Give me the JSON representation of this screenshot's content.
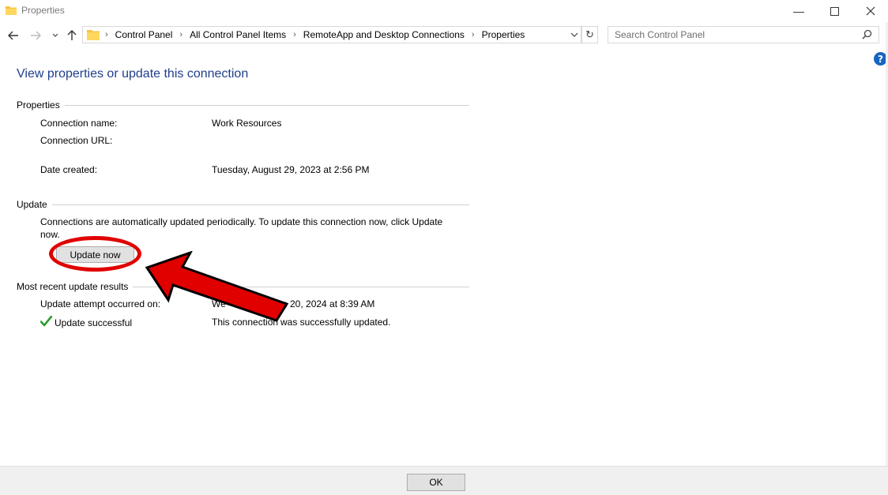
{
  "window": {
    "title": "Properties",
    "controls": {
      "minimize": "minimize-icon",
      "maximize": "maximize-icon",
      "close": "close-icon"
    }
  },
  "addressbar": {
    "breadcrumbs": [
      "Control Panel",
      "All Control Panel Items",
      "RemoteApp and Desktop Connections",
      "Properties"
    ]
  },
  "search": {
    "placeholder": "Search Control Panel"
  },
  "page": {
    "title": "View properties or update this connection",
    "properties": {
      "header": "Properties",
      "connection_name_label": "Connection name:",
      "connection_name_value": "Work Resources",
      "connection_url_label": "Connection URL:",
      "connection_url_value": "",
      "date_created_label": "Date created:",
      "date_created_value": "Tuesday, August 29, 2023 at 2:56 PM"
    },
    "update": {
      "header": "Update",
      "description_line1": "Connections are automatically updated periodically.  To update this connection now, click Update",
      "description_line2": "now.",
      "button_label": "Update now"
    },
    "results": {
      "header": "Most recent update results",
      "attempt_label": "Update attempt occurred on:",
      "attempt_value_left": "We",
      "attempt_value_right": "n 20, 2024 at 8:39 AM",
      "status_label": "Update successful",
      "status_value_left": "This connection",
      "status_value_right": "was successfully updated."
    }
  },
  "footer": {
    "ok_label": "OK"
  },
  "colors": {
    "title_blue": "#1e3e8a",
    "annotation_red": "#e00000",
    "success_green": "#2e9e2e",
    "folder_yellow": "#f4c542",
    "help_blue": "#1565c0"
  }
}
